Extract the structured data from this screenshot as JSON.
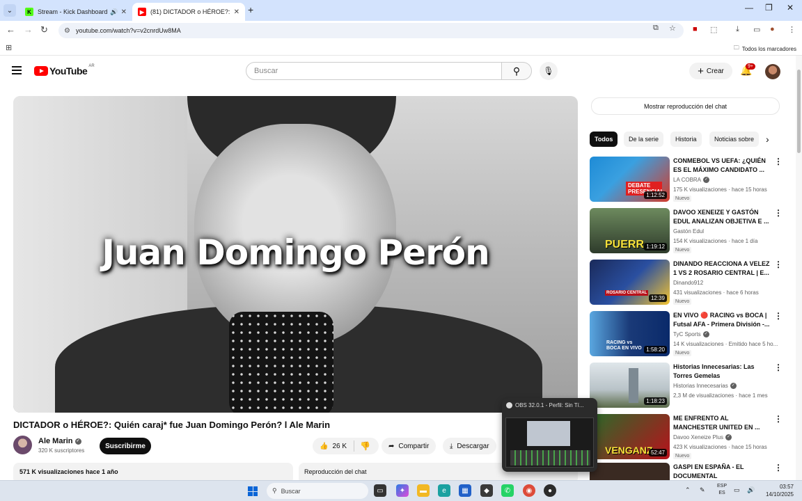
{
  "browser": {
    "tabs": [
      {
        "title": "Stream - Kick Dashboard",
        "favicon": "kick-icon",
        "active": false,
        "audio": true
      },
      {
        "title": "(81) DICTADOR o HÉROE?: Quién",
        "favicon": "youtube-icon",
        "active": true
      }
    ],
    "url": "youtube.com/watch?v=v2cnrdUw8MA",
    "bookmarks_folder": "Todos los marcadores"
  },
  "youtube": {
    "logo_text": "YouTube",
    "country_code": "AR",
    "search_placeholder": "Buscar",
    "create_label": "Crear",
    "notifications_count": "9+"
  },
  "video": {
    "overlay_text": "Juan Domingo Perón",
    "title": "DICTADOR o HÉROE?: Quién caraj* fue Juan Domingo Perón? l Ale Marin",
    "channel": "Ale Marin",
    "subscribers": "320 K suscriptores",
    "subscribe_label": "Suscribirme",
    "likes": "26 K",
    "share_label": "Compartir",
    "download_label": "Descargar",
    "views_date": "571 K visualizaciones  hace 1 año",
    "chat_replay_label": "Reproducción del chat"
  },
  "sidebar": {
    "show_chat_label": "Mostrar reproducción del chat",
    "chips": [
      "Todos",
      "De la serie",
      "Historia",
      "Noticias sobre"
    ],
    "recommendations": [
      {
        "title": "CONMEBOL VS UEFA: ¿QUIÉN ES EL MÁXIMO CANDIDATO ...",
        "channel": "LA COBRA",
        "verified": true,
        "meta": "175 K visualizaciones · hace 15 horas",
        "badge": "Nuevo",
        "duration": "1:12:52",
        "thumb_text": "DEBATE PRESENCIAL"
      },
      {
        "title": "DAVOO XENEIZE Y GASTÓN EDUL ANALIZAN OBJETIVA E ...",
        "channel": "Gastón Edul",
        "verified": false,
        "meta": "154 K visualizaciones · hace 1 día",
        "badge": "Nuevo",
        "duration": "1:19:12",
        "thumb_text": "PUERR"
      },
      {
        "title": "DINANDO REACCIONA A VELEZ 1 VS 2 ROSARIO CENTRAL | E...",
        "channel": "Dinando912",
        "verified": false,
        "meta": "431 visualizaciones · hace 6 horas",
        "badge": "Nuevo",
        "duration": "12:39",
        "thumb_text": "ROSARIO CENTRAL"
      },
      {
        "title": "EN VIVO 🔴 RACING vs BOCA | Futsal AFA - Primera División -...",
        "channel": "TyC Sports",
        "verified": true,
        "meta": "14 K visualizaciones · Emitido hace 5 ho...",
        "badge": "Nuevo",
        "duration": "1:58:20",
        "thumb_text": "RACING vs BOCA EN VIVO"
      },
      {
        "title": "Historias Innecesarias: Las Torres Gemelas",
        "channel": "Historias Innecesarias",
        "verified": true,
        "meta": "2,3 M de visualizaciones · hace 1 mes",
        "badge": "",
        "duration": "1:18:23",
        "thumb_text": ""
      },
      {
        "title": "ME ENFRENTO AL MANCHESTER UNITED EN ...",
        "channel": "Davoo Xeneize Plus",
        "verified": true,
        "meta": "423 K visualizaciones · hace 15 horas",
        "badge": "Nuevo",
        "duration": "52:47",
        "thumb_text": "VENGANZ"
      },
      {
        "title": "GASPI EN ESPAÑA - EL DOCUMENTAL",
        "channel": "",
        "verified": false,
        "meta": "",
        "badge": "",
        "duration": "",
        "thumb_text": ""
      }
    ]
  },
  "obs_popup": {
    "title": "OBS 32.0.1 - Perfil: Sin Tí..."
  },
  "taskbar": {
    "search_placeholder": "Buscar",
    "lang_top": "ESP",
    "lang_bottom": "ES",
    "time": "03:57",
    "date": "14/10/2025"
  }
}
